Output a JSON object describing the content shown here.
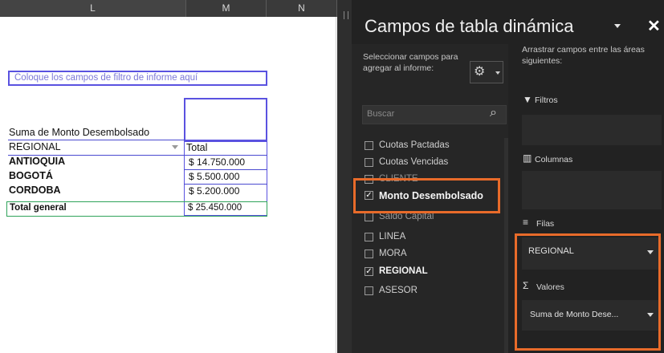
{
  "sheet": {
    "columns": [
      "L",
      "M",
      "N"
    ],
    "report_filter_placeholder": "Coloque los campos de filtro de informe aquí",
    "pivot_caption": "Suma de Monto Desembolsado",
    "row_header": "REGIONAL",
    "value_header": "Total",
    "rows": [
      {
        "label": "ANTIOQUIA",
        "value": "$ 14.750.000"
      },
      {
        "label": "BOGOTÁ",
        "value": "$   5.500.000"
      },
      {
        "label": "CORDOBA",
        "value": "$   5.200.000"
      }
    ],
    "grand_total": {
      "label": "Total general",
      "value": "$ 25.450.000"
    }
  },
  "pane": {
    "title": "Campos de tabla dinámica",
    "close_glyph": "✕",
    "select_fields_text": "Seleccionar campos para agregar al informe:",
    "drag_instruction": "Arrastrar campos entre las áreas siguientes:",
    "search_placeholder": "Buscar",
    "fields": [
      {
        "label": "Cuotas Pactadas",
        "checked": false
      },
      {
        "label": "Cuotas Vencidas",
        "checked": false
      },
      {
        "label": "CLIENTE",
        "checked": false
      },
      {
        "label": "Monto Desembolsado",
        "checked": true
      },
      {
        "label": "Saldo Capital",
        "checked": false
      },
      {
        "label": "LINEA",
        "checked": false
      },
      {
        "label": "MORA",
        "checked": false
      },
      {
        "label": "REGIONAL",
        "checked": true
      },
      {
        "label": "ASESOR",
        "checked": false
      }
    ],
    "zones": {
      "filters_label": "Filtros",
      "columns_label": "Columnas",
      "rows_label": "Filas",
      "rows_value": "REGIONAL",
      "values_label": "Valores",
      "values_value": "Suma de Monto Dese..."
    },
    "icons": {
      "gear": "gear-icon",
      "search": "search-icon",
      "filter": "filter-icon",
      "columns": "columns-icon",
      "rows": "rows-icon",
      "sigma": "sigma-icon"
    }
  },
  "colors": {
    "highlight": "#e86b2a",
    "pane_bg": "#222222",
    "pivot_border": "#5a52e0",
    "total_border": "#2fa35a"
  }
}
